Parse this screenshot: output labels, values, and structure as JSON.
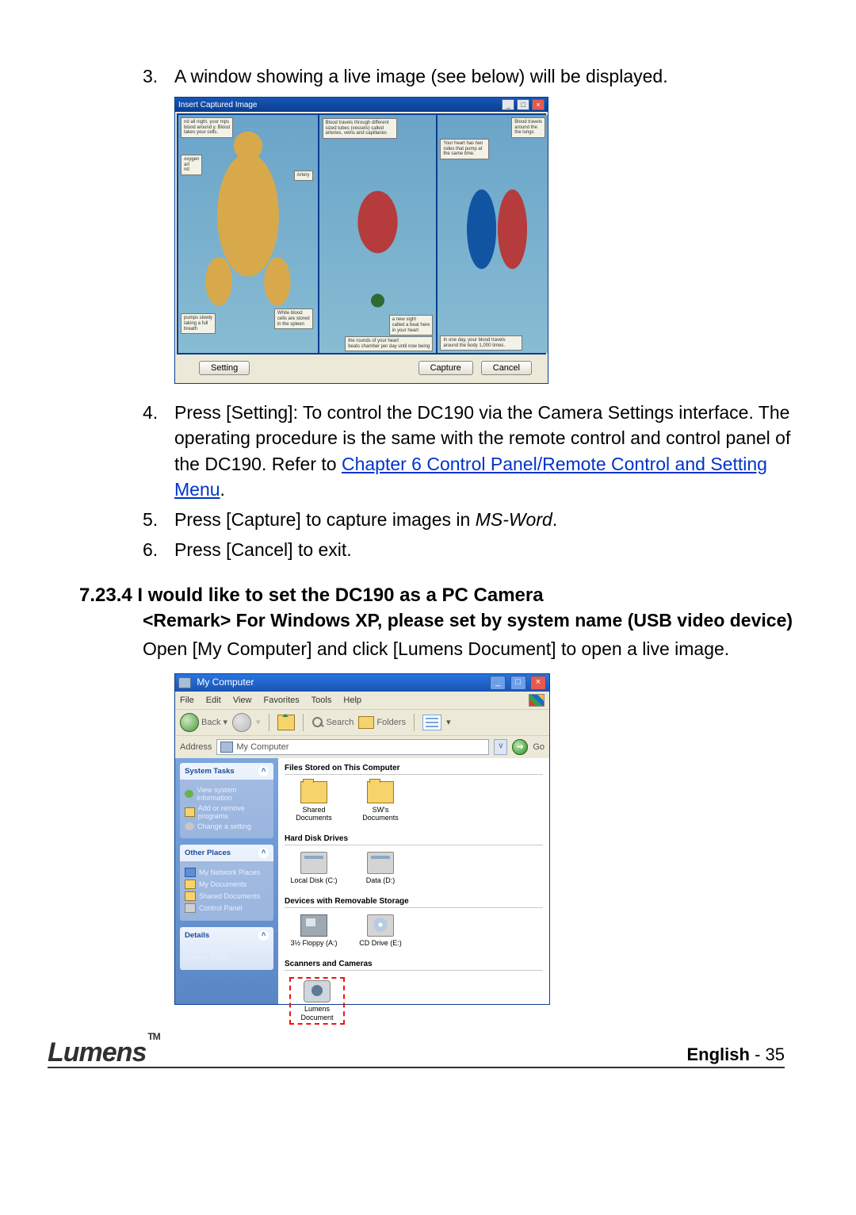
{
  "steps": {
    "s3": {
      "num": "3.",
      "text": "A window showing a live image (see below) will be displayed."
    },
    "s4": {
      "num": "4.",
      "part1": "Press [Setting]: To control the DC190 via the Camera Settings interface. The operating procedure is the same with the remote control and control panel of the DC190. Refer to ",
      "link": "Chapter 6 Control Panel/Remote Control and Setting Menu",
      "part2": "."
    },
    "s5": {
      "num": "5.",
      "part1": "Press [Capture] to capture images in ",
      "em": "MS-Word",
      "part2": "."
    },
    "s6": {
      "num": "6.",
      "text": "Press [Cancel] to exit."
    }
  },
  "section": {
    "number": "7.23.4",
    "title": "I would like to set the DC190 as a PC Camera",
    "remark": "<Remark> For Windows XP, please set by system name (USB video device)",
    "body": "Open [My Computer] and click [Lumens Document] to open a live image."
  },
  "ici": {
    "title": "Insert Captured Image",
    "btn_setting": "Setting",
    "btn_capture": "Capture",
    "btn_cancel": "Cancel"
  },
  "mc": {
    "title": "My Computer",
    "menu": {
      "file": "File",
      "edit": "Edit",
      "view": "View",
      "favorites": "Favorites",
      "tools": "Tools",
      "help": "Help"
    },
    "toolbar": {
      "back": "Back",
      "search": "Search",
      "folders": "Folders"
    },
    "address": {
      "label": "Address",
      "value": "My Computer",
      "go": "Go"
    },
    "sidebar": {
      "systemTasks": {
        "hdr": "System Tasks",
        "i1": "View system information",
        "i2": "Add or remove programs",
        "i3": "Change a setting"
      },
      "otherPlaces": {
        "hdr": "Other Places",
        "i1": "My Network Places",
        "i2": "My Documents",
        "i3": "Shared Documents",
        "i4": "Control Panel"
      },
      "details": {
        "hdr": "Details",
        "l1": "My Computer",
        "l2": "System Folder"
      }
    },
    "cats": {
      "c1": "Files Stored on This Computer",
      "c2": "Hard Disk Drives",
      "c3": "Devices with Removable Storage",
      "c4": "Scanners and Cameras"
    },
    "items": {
      "shared": "Shared Documents",
      "swsdoc": "SW's Documents",
      "localc": "Local Disk (C:)",
      "datad": "Data (D:)",
      "floppy": "3½ Floppy (A:)",
      "cddrive": "CD Drive (E:)",
      "lumens": "Lumens Document"
    }
  },
  "footer": {
    "brand": "Lumens",
    "tm": "TM",
    "lang": "English",
    "sep": " -  ",
    "page": "35"
  }
}
